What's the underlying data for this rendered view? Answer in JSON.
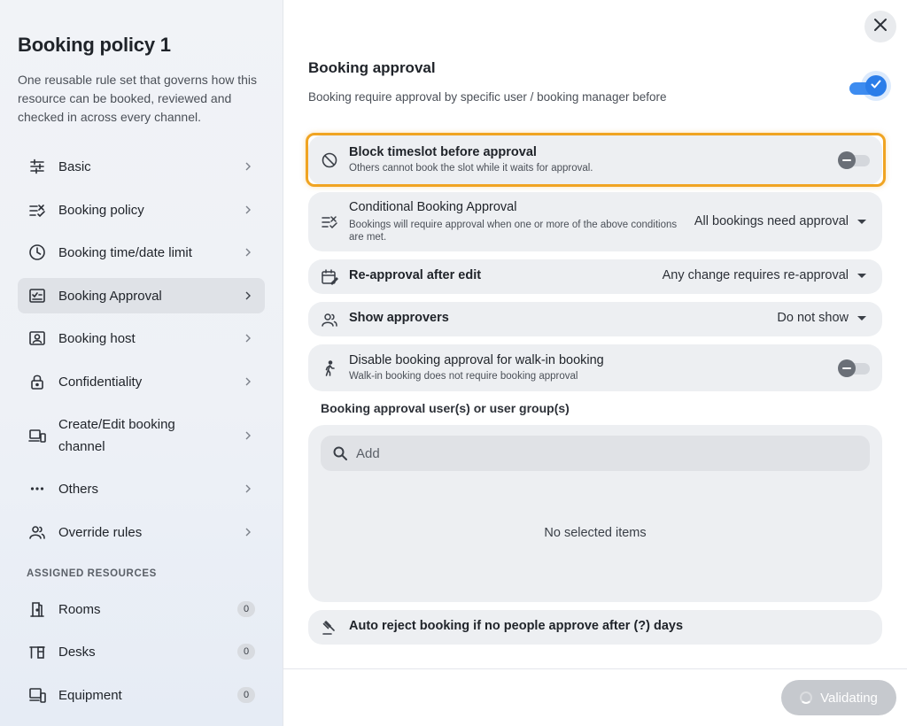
{
  "sidebar": {
    "title": "Booking policy 1",
    "description": "One reusable rule set that governs how this resource can be booked, reviewed and checked in across every channel.",
    "items": [
      {
        "label": "Basic",
        "icon": "sliders-icon"
      },
      {
        "label": "Booking policy",
        "icon": "rule-checklist-icon"
      },
      {
        "label": "Booking time/date limit",
        "icon": "clock-icon"
      },
      {
        "label": "Booking Approval",
        "icon": "approval-icon",
        "active": true
      },
      {
        "label": "Booking host",
        "icon": "host-badge-icon"
      },
      {
        "label": "Confidentiality",
        "icon": "lock-icon"
      },
      {
        "label": "Create/Edit booking channel",
        "icon": "devices-icon"
      },
      {
        "label": "Others",
        "icon": "more-dots-icon"
      },
      {
        "label": "Override rules",
        "icon": "people-icon"
      }
    ],
    "resources_label": "ASSIGNED RESOURCES",
    "resources": [
      {
        "label": "Rooms",
        "count": "0",
        "icon": "door-icon"
      },
      {
        "label": "Desks",
        "count": "0",
        "icon": "desk-icon"
      },
      {
        "label": "Equipment",
        "count": "0",
        "icon": "equipment-icon"
      }
    ]
  },
  "main": {
    "title": "Booking approval",
    "description": "Booking require approval by specific user / booking manager before",
    "approval_enabled": true,
    "rows": {
      "block": {
        "title": "Block timeslot before approval",
        "subtitle": "Others cannot book the slot while it waits for approval.",
        "enabled": false
      },
      "conditional": {
        "title": "Conditional Booking Approval",
        "subtitle": "Bookings will require approval when one or more of the above conditions are met.",
        "value": "All bookings need approval"
      },
      "reapproval": {
        "title": "Re-approval after edit",
        "value": "Any change requires re-approval"
      },
      "approvers": {
        "title": "Show approvers",
        "value": "Do not show"
      },
      "walkin": {
        "title": "Disable booking approval for walk-in booking",
        "subtitle": "Walk-in booking does not require booking approval",
        "enabled": false
      },
      "autoreject": {
        "title": "Auto reject booking if no people approve after (?) days"
      }
    },
    "users_section_label": "Booking approval user(s) or user group(s)",
    "search_placeholder": "Add",
    "empty_text": "No selected items",
    "validate_label": "Validating"
  },
  "colors": {
    "accent": "#2b7de9",
    "highlight": "#f0a422",
    "row_bg": "#edeff2"
  }
}
